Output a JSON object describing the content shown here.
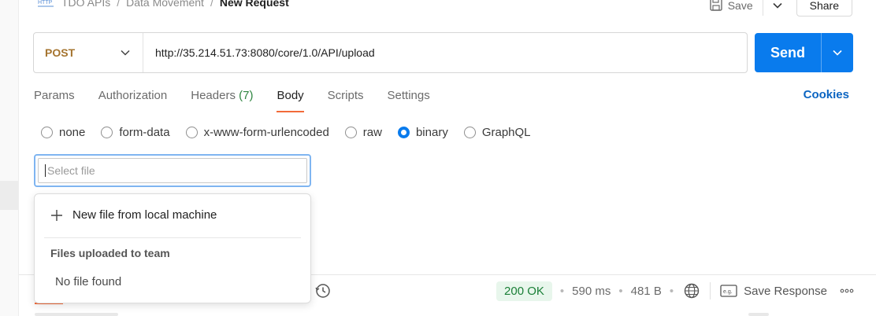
{
  "breadcrumb": {
    "icon": "http-icon",
    "items": [
      "TDO APIs",
      "Data Movement"
    ],
    "separator": "/",
    "current": "New Request"
  },
  "top_actions": {
    "save_label": "Save",
    "share_label": "Share"
  },
  "request": {
    "method": "POST",
    "url": "http://35.214.51.73:8080/core/1.0/API/upload",
    "send_label": "Send"
  },
  "tabs": [
    {
      "label": "Params",
      "active": false
    },
    {
      "label": "Authorization",
      "active": false
    },
    {
      "label": "Headers",
      "count": "(7)",
      "active": false
    },
    {
      "label": "Body",
      "active": true
    },
    {
      "label": "Scripts",
      "active": false
    },
    {
      "label": "Settings",
      "active": false
    }
  ],
  "cookies_label": "Cookies",
  "body_types": [
    {
      "label": "none",
      "checked": false
    },
    {
      "label": "form-data",
      "checked": false
    },
    {
      "label": "x-www-form-urlencoded",
      "checked": false
    },
    {
      "label": "raw",
      "checked": false
    },
    {
      "label": "binary",
      "checked": true
    },
    {
      "label": "GraphQL",
      "checked": false
    }
  ],
  "file_select": {
    "placeholder": "Select file",
    "value": ""
  },
  "dropdown": {
    "new_file_label": "New file from local machine",
    "section_title": "Files uploaded to team",
    "empty_label": "No file found"
  },
  "response": {
    "status": "200 OK",
    "time": "590 ms",
    "size": "481 B",
    "save_label": "Save Response",
    "save_icon_text": "e.g."
  },
  "colors": {
    "accent_blue": "#097bed",
    "method_post": "#a5742f",
    "status_ok_bg": "#e8f6ec",
    "status_ok_text": "#1a7f37",
    "active_tab_underline": "#f26b3a"
  }
}
